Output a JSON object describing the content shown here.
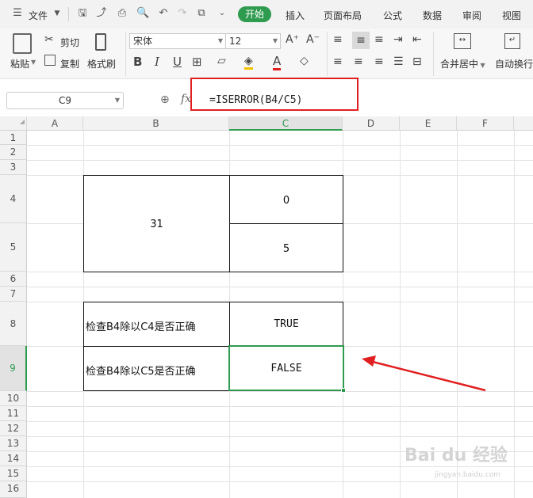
{
  "menubar": {
    "file_label": "文件",
    "tabs": [
      "开始",
      "插入",
      "页面布局",
      "公式",
      "数据",
      "审阅",
      "视图"
    ],
    "active_tab": "开始"
  },
  "ribbon": {
    "paste_label": "粘贴",
    "cut_label": "剪切",
    "copy_label": "复制",
    "format_painter_label": "格式刷",
    "font_name": "宋体",
    "font_size": "12",
    "merge_label": "合并居中",
    "wrap_label": "自动换行"
  },
  "formula_bar": {
    "cell_ref": "C9",
    "fx": "fx",
    "formula": "=ISERROR(B4/C5)"
  },
  "columns": [
    "A",
    "B",
    "C",
    "D",
    "E",
    "F"
  ],
  "rows": [
    "1",
    "2",
    "3",
    "4",
    "5",
    "6",
    "7",
    "8",
    "9",
    "10",
    "11",
    "12",
    "13",
    "14",
    "15",
    "16"
  ],
  "cells": {
    "B4": "31",
    "C4": "0",
    "C5": "5",
    "B8": "检查B4除以C4是否正确",
    "C8": "TRUE",
    "B9": "检查B4除以C5是否正确",
    "C9": "FALSE"
  },
  "watermark": {
    "brand": "Bai du 经验",
    "url": "jingyan.baidu.com"
  },
  "colors": {
    "accent": "#2e9b4f",
    "highlight_box": "#e02020",
    "arrow": "#e02020"
  }
}
